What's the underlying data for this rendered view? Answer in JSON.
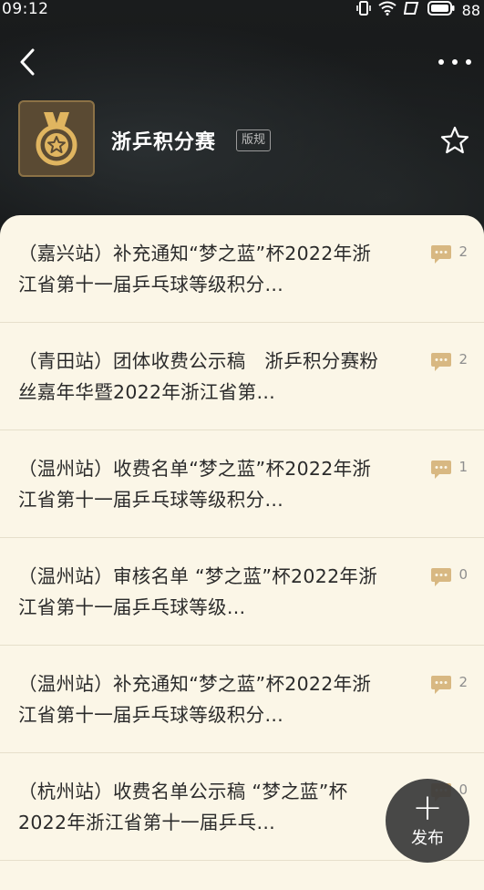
{
  "status_bar": {
    "time": "09:12",
    "battery": "88"
  },
  "forum": {
    "name": "浙乒积分赛",
    "tag": "版规"
  },
  "posts": [
    {
      "title": "（嘉兴站）补充通知“梦之蓝”杯2022年浙江省第十一届乒乓球等级积分…",
      "comments": "2"
    },
    {
      "title": "（青田站）团体收费公示稿　浙乒积分赛粉丝嘉年华暨2022年浙江省第…",
      "comments": "2"
    },
    {
      "title": "（温州站）收费名单“梦之蓝”杯2022年浙江省第十一届乒乓球等级积分…",
      "comments": "1"
    },
    {
      "title": "（温州站）审核名单 “梦之蓝”杯2022年浙江省第十一届乒乓球等级…",
      "comments": "0"
    },
    {
      "title": "（温州站）补充通知“梦之蓝”杯2022年浙江省第十一届乒乓球等级积分…",
      "comments": "2"
    },
    {
      "title": "（杭州站）收费名单公示稿 “梦之蓝”杯2022年浙江省第十一届乒乓…",
      "comments": "0"
    }
  ],
  "fab": {
    "label": "发布",
    "icon": "plus-icon"
  },
  "colors": {
    "list_bg": "#fbf6e7",
    "comment_icon": "#d8b882",
    "logo_gold": "#e0b560"
  }
}
